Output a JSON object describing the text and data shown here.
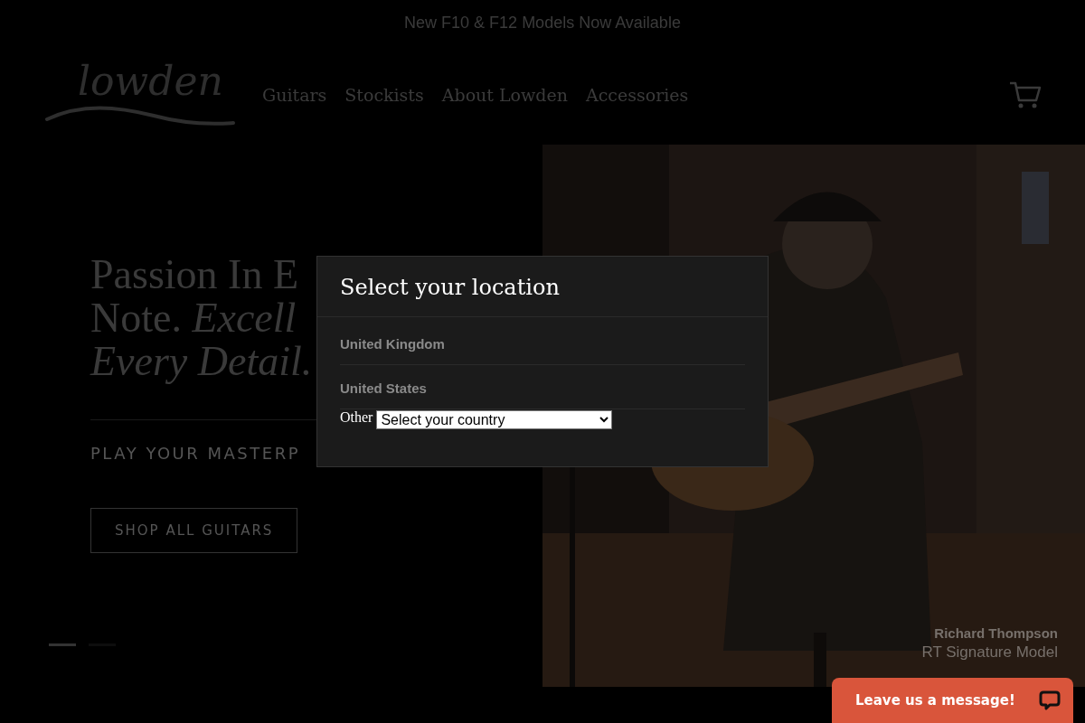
{
  "announcement": "New F10 & F12 Models Now Available",
  "header": {
    "logo": "lowden",
    "nav": [
      {
        "label": "Guitars"
      },
      {
        "label": "Stockists"
      },
      {
        "label": "About Lowden"
      },
      {
        "label": "Accessories"
      }
    ]
  },
  "hero": {
    "heading_lines": [
      "Passion In E",
      "Note. *Excell*",
      "*Every Detail.*"
    ],
    "subheading": "PLAY YOUR MASTERP",
    "button": "SHOP ALL GUITARS",
    "image": {
      "kind": "picture"
    },
    "caption": {
      "name": "Richard Thompson",
      "model": "RT Signature Model"
    },
    "slides": [
      {
        "selected": true
      },
      {
        "selected": false
      }
    ]
  },
  "modal": {
    "title": "Select your location",
    "options": [
      "United Kingdom",
      "United States"
    ],
    "other_label": "Other",
    "select_placeholder": "Select your country"
  },
  "chat": {
    "label": "Leave us a message!"
  }
}
